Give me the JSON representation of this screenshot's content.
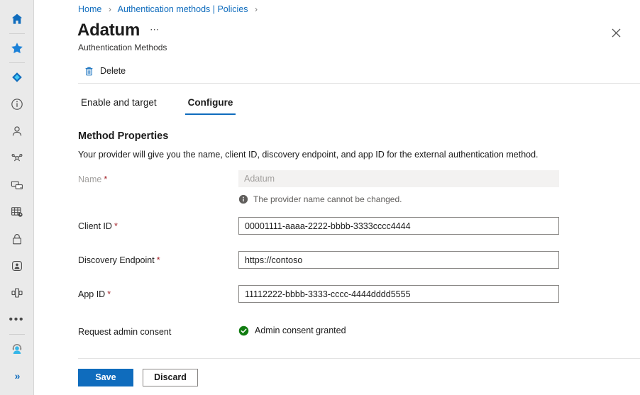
{
  "rail": {
    "items": [
      {
        "name": "home-icon",
        "label": "Home"
      },
      {
        "name": "favorites-star-icon",
        "label": "Favorites"
      },
      {
        "name": "azure-diamond-icon",
        "label": "Azure resource"
      },
      {
        "name": "info-circle-icon",
        "label": "Information"
      },
      {
        "name": "user-icon",
        "label": "Users"
      },
      {
        "name": "groups-icon",
        "label": "Groups"
      },
      {
        "name": "devices-icon",
        "label": "Devices"
      },
      {
        "name": "applications-grid-icon",
        "label": "Applications"
      },
      {
        "name": "lock-icon",
        "label": "Protection"
      },
      {
        "name": "identity-governance-icon",
        "label": "Identity governance"
      },
      {
        "name": "external-identities-icon",
        "label": "External identities"
      },
      {
        "name": "more-ellipsis-icon",
        "label": "More"
      },
      {
        "name": "support-agent-icon",
        "label": "Support"
      },
      {
        "name": "expand-chevrons-icon",
        "label": "Expand"
      }
    ]
  },
  "breadcrumb": {
    "items": [
      "Home",
      "Authentication methods | Policies"
    ],
    "separator": "›",
    "trailing_separator": "›"
  },
  "header": {
    "title": "Adatum",
    "ellipsis": "⋯",
    "subtitle": "Authentication Methods",
    "close_icon": "close-icon"
  },
  "command_bar": {
    "delete_label": "Delete",
    "delete_icon": "trash-icon"
  },
  "tabs": [
    {
      "label": "Enable and target",
      "active": false
    },
    {
      "label": "Configure",
      "active": true
    }
  ],
  "section": {
    "title": "Method Properties",
    "description": "Your provider will give you the name, client ID, discovery endpoint, and app ID for the external authentication method."
  },
  "form": {
    "name": {
      "label": "Name",
      "required": "*",
      "value": "Adatum",
      "placeholder": "Adatum",
      "readonly": true,
      "hint": "The provider name cannot be changed.",
      "hint_icon": "info-filled-icon"
    },
    "client_id": {
      "label": "Client ID",
      "required": "*",
      "value": "00001111-aaaa-2222-bbbb-3333cccc4444",
      "placeholder": "Client ID"
    },
    "discovery_endpoint": {
      "label": "Discovery Endpoint",
      "required": "*",
      "value": "https://contoso",
      "placeholder": "Discovery Endpoint"
    },
    "app_id": {
      "label": "App ID",
      "required": "*",
      "value": "11112222-bbbb-3333-cccc-4444dddd5555",
      "placeholder": "App ID"
    },
    "admin_consent": {
      "label": "Request admin consent",
      "status": "Admin consent granted",
      "status_icon": "check-circle-icon"
    }
  },
  "footer": {
    "save_label": "Save",
    "discard_label": "Discard"
  },
  "colors": {
    "accent": "#0f6cbd",
    "link": "#0f6cbd",
    "required_asterisk": "#a4262c",
    "success": "#107c10",
    "rail_background": "#eaeaea",
    "info": "#605e5c"
  }
}
